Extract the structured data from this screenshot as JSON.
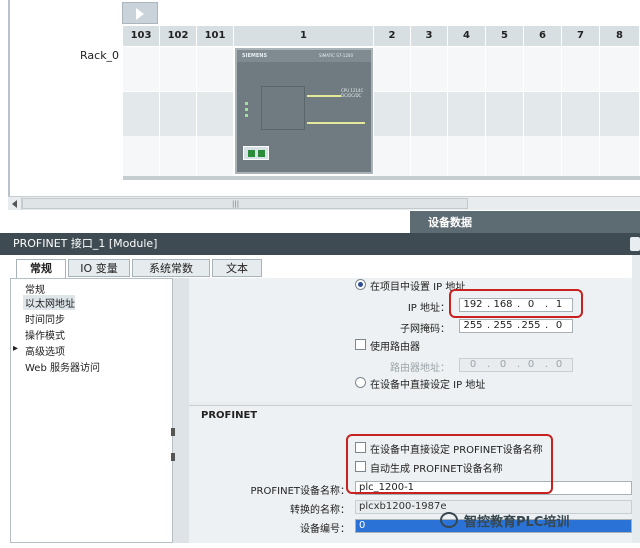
{
  "rack": {
    "name": "Rack_0",
    "slots": [
      "103",
      "102",
      "101",
      "1",
      "2",
      "3",
      "4",
      "5",
      "6",
      "7",
      "8"
    ],
    "cpu": {
      "brand": "SIEMENS",
      "model": "SIMATIC S7-1200",
      "label_lines": [
        "CPU 1214C",
        "DC/DC/DC"
      ]
    }
  },
  "device_data_label": "设备数据",
  "properties": {
    "title": "PROFINET 接口_1 [Module]",
    "tabs": [
      "常规",
      "IO 变量",
      "系统常数",
      "文本"
    ],
    "active_tab": "常规",
    "nav": [
      "常规",
      "以太网地址",
      "时间同步",
      "操作模式",
      "高级选项",
      "Web 服务器访问"
    ],
    "selected_nav": "以太网地址"
  },
  "ip": {
    "option_project": "在项目中设置 IP 地址",
    "ip_label": "IP 地址：",
    "ip_value": [
      "192",
      "168",
      "0",
      "1"
    ],
    "mask_label": "子网掩码：",
    "mask_value": [
      "255",
      "255",
      "255",
      "0"
    ],
    "router_checkbox": "使用路由器",
    "router_label": "路由器地址：",
    "router_value": [
      "0",
      "0",
      "0",
      "0"
    ],
    "option_device": "在设备中直接设定 IP 地址"
  },
  "profinet": {
    "heading": "PROFINET",
    "chk_set_in_device": "在设备中直接设定 PROFINET设备名称",
    "chk_auto_generate": "自动生成 PROFINET设备名称",
    "device_name_label": "PROFINET设备名称：",
    "device_name_value": "plc_1200-1",
    "converted_label": "转换的名称：",
    "converted_value": "plcxb1200-1987e",
    "device_number_label": "设备编号：",
    "device_number_value": "0"
  },
  "watermark": "智控教育PLC培训",
  "colors": {
    "header_bar": "#3f4b52",
    "device_data_bar": "#5d6b72",
    "highlight_red": "#c8211f",
    "selected_blue": "#2a72d6"
  }
}
